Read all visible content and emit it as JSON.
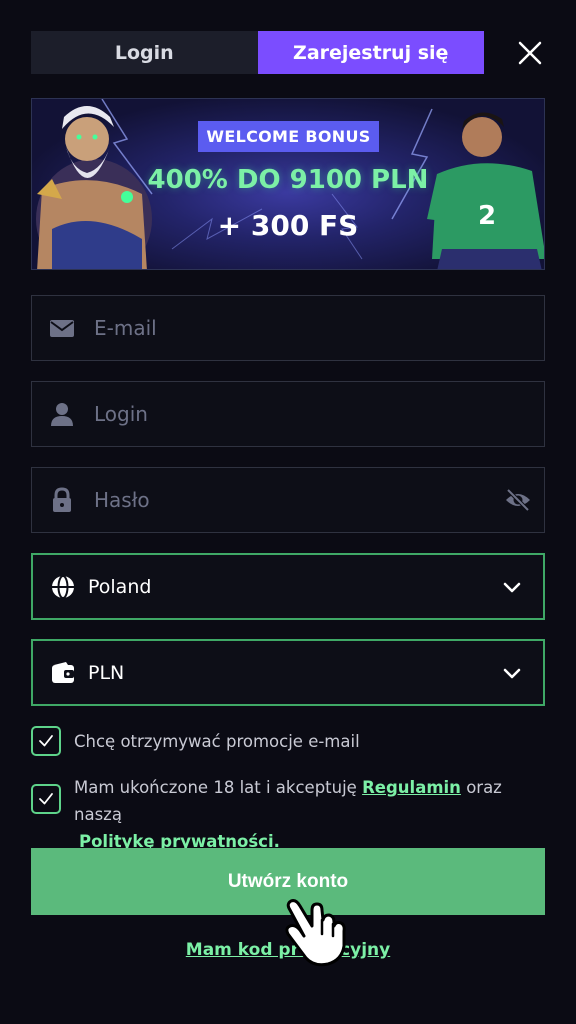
{
  "tabs": {
    "login_label": "Login",
    "register_label": "Zarejestruj się",
    "active": "register"
  },
  "banner": {
    "badge": "WELCOME BONUS",
    "headline": "400% DO 9100 PLN",
    "subline": "+ 300 FS"
  },
  "form": {
    "email": {
      "placeholder": "E-mail",
      "value": "",
      "icon": "envelope-icon"
    },
    "login": {
      "placeholder": "Login",
      "value": "",
      "icon": "user-icon"
    },
    "password": {
      "placeholder": "Hasło",
      "value": "",
      "icon": "lock-icon",
      "toggle_icon": "eye-off-icon"
    },
    "country": {
      "value": "Poland",
      "icon": "globe-icon"
    },
    "currency": {
      "value": "PLN",
      "icon": "wallet-icon"
    }
  },
  "consents": {
    "promo": {
      "label": "Chcę otrzymywać promocje e-mail",
      "checked": true
    },
    "terms": {
      "text_before": "Mam ukończone 18 lat i akceptuję",
      "terms_link": "Regulamin",
      "text_middle": "oraz naszą",
      "privacy_link": "Politykę prywatności.",
      "checked": true
    }
  },
  "actions": {
    "submit_label": "Utwórz konto",
    "promo_code_link": "Mam kod promocyjny"
  },
  "colors": {
    "accent_purple": "#7b4dff",
    "accent_green": "#5bba7c",
    "link_green": "#7cf0a6",
    "background": "#0b0b14"
  }
}
